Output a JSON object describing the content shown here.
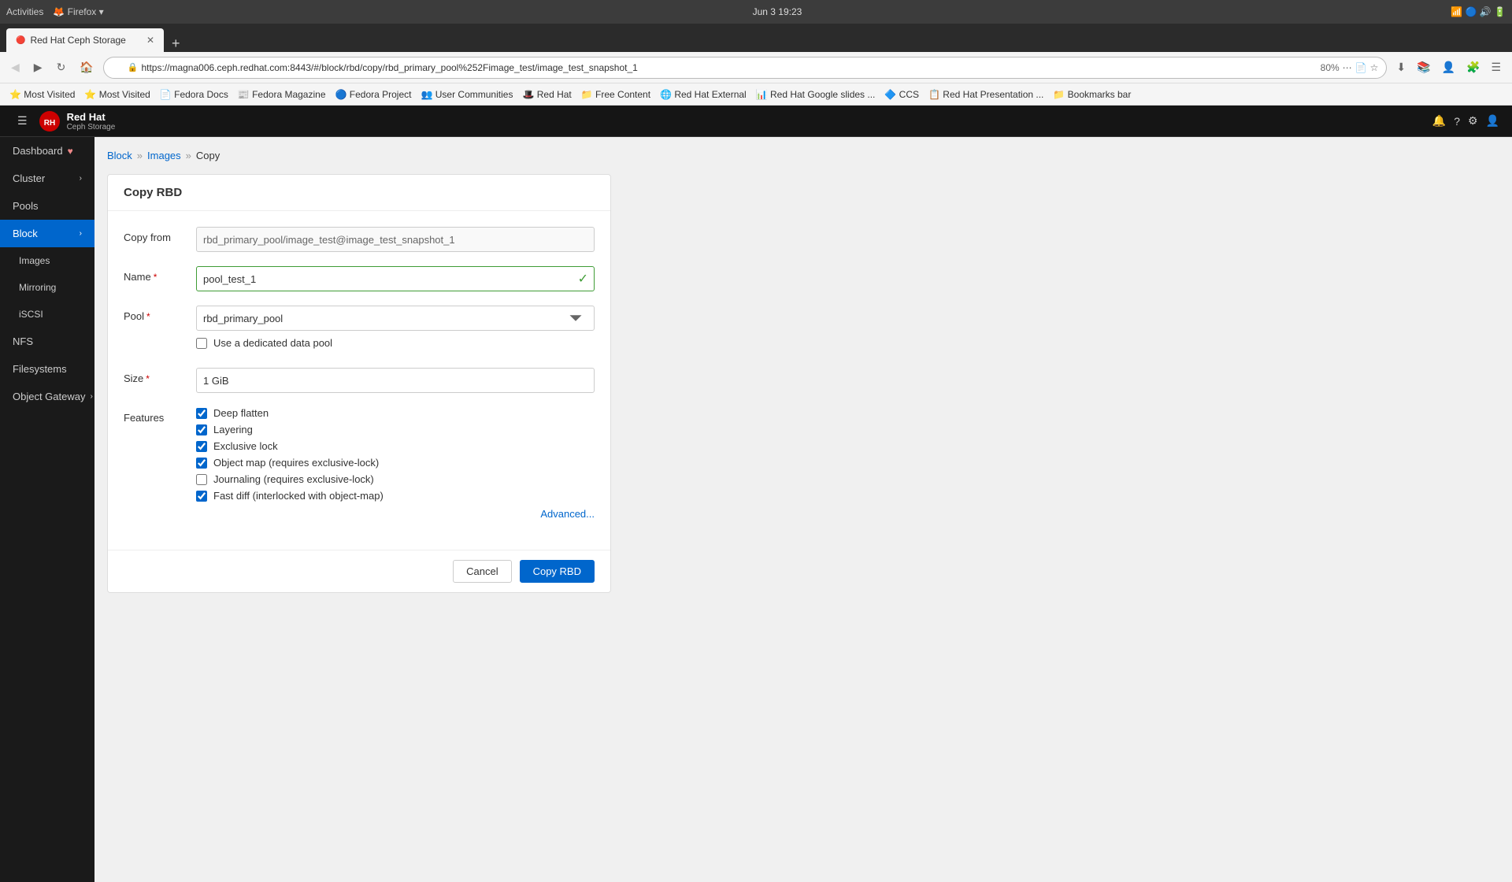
{
  "browser": {
    "titlebar": {
      "left": "Activities   Firefox ▾",
      "center": "Jun 3  19:23",
      "right": ""
    },
    "tab": {
      "title": "Red Hat Ceph Storage",
      "favicon": "🔴"
    },
    "address": "https://magna006.ceph.redhat.com:8443/#/block/rbd/copy/rbd_primary_pool%252Fimage_test/image_test_snapshot_1",
    "zoom": "80%"
  },
  "bookmarks": [
    "Most Visited",
    "Most Visited",
    "Fedora Docs",
    "Fedora Magazine",
    "Fedora Project",
    "User Communities",
    "Red Hat",
    "Free Content",
    "Red Hat External",
    "Red Hat Google slides ...",
    "CCS",
    "Red Hat Presentation ...",
    "Bookmarks bar"
  ],
  "app": {
    "logo": "Red Hat",
    "logo_sub": "Ceph Storage",
    "topbar_icons": [
      "≡",
      "?",
      "⚙",
      "👤"
    ]
  },
  "sidebar": {
    "items": [
      {
        "label": "Dashboard",
        "icon": "♥",
        "active": false,
        "sub": false
      },
      {
        "label": "Cluster",
        "icon": "",
        "active": false,
        "sub": false,
        "arrow": "›"
      },
      {
        "label": "Pools",
        "icon": "",
        "active": false,
        "sub": false
      },
      {
        "label": "Block",
        "icon": "",
        "active": true,
        "sub": false,
        "arrow": "›"
      },
      {
        "label": "Images",
        "icon": "",
        "active": false,
        "sub": true
      },
      {
        "label": "Mirroring",
        "icon": "",
        "active": false,
        "sub": true
      },
      {
        "label": "iSCSI",
        "icon": "",
        "active": false,
        "sub": true
      },
      {
        "label": "NFS",
        "icon": "",
        "active": false,
        "sub": false
      },
      {
        "label": "Filesystems",
        "icon": "",
        "active": false,
        "sub": false
      },
      {
        "label": "Object Gateway",
        "icon": "",
        "active": false,
        "sub": false,
        "arrow": "›"
      }
    ]
  },
  "breadcrumb": {
    "items": [
      "Block",
      "Images",
      "Copy"
    ]
  },
  "form": {
    "title": "Copy RBD",
    "copy_from_label": "Copy from",
    "copy_from_value": "rbd_primary_pool/image_test@image_test_snapshot_1",
    "name_label": "Name",
    "name_value": "pool_test_1",
    "pool_label": "Pool",
    "pool_value": "rbd_primary_pool",
    "pool_options": [
      "rbd_primary_pool"
    ],
    "use_data_pool_label": "Use a dedicated data pool",
    "size_label": "Size",
    "size_value": "1 GiB",
    "features_label": "Features",
    "features": [
      {
        "label": "Deep flatten",
        "checked": true
      },
      {
        "label": "Layering",
        "checked": true
      },
      {
        "label": "Exclusive lock",
        "checked": true
      },
      {
        "label": "Object map (requires exclusive-lock)",
        "checked": true
      },
      {
        "label": "Journaling (requires exclusive-lock)",
        "checked": false
      },
      {
        "label": "Fast diff (interlocked with object-map)",
        "checked": true
      }
    ],
    "advanced_label": "Advanced...",
    "cancel_label": "Cancel",
    "submit_label": "Copy RBD"
  }
}
